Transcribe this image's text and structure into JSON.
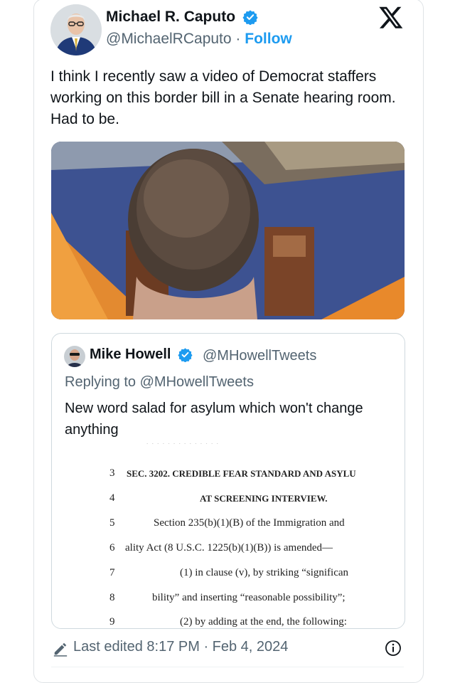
{
  "tweet": {
    "author_name": "Michael R. Caputo",
    "handle": "@MichaelRCaputo",
    "separator": "·",
    "follow_label": "Follow",
    "text": "I think I recently saw a video of Democrat staffers working on this border bill in a Senate hearing room. Had to be.",
    "media_icon": "video-still-image",
    "verified_icon": "verified-badge-icon",
    "platform_icon": "x-logo-icon"
  },
  "quote": {
    "author_name": "Mike Howell",
    "handle": "@MHowellTweets",
    "reply_context": "Replying to @MHowellTweets",
    "text": "New word salad for asylum which won't change anything",
    "document_lines": [
      {
        "num": "3",
        "text": "SEC. 3202. CREDIBLE FEAR STANDARD AND ASYLU"
      },
      {
        "num": "4",
        "text": "AT SCREENING INTERVIEW."
      },
      {
        "num": "5",
        "text": "Section 235(b)(1)(B) of the Immigration and"
      },
      {
        "num": "6",
        "text": "ality Act (8 U.S.C. 1225(b)(1)(B)) is amended—"
      },
      {
        "num": "7",
        "text": "(1) in clause (v), by striking “significan"
      },
      {
        "num": "8",
        "text": "bility” and inserting “reasonable possibility”;"
      },
      {
        "num": "9",
        "text": "(2) by adding at the end, the following:"
      }
    ]
  },
  "footer": {
    "edited_text": "Last edited 8:17 PM · Feb 4, 2024",
    "edit_icon": "pencil-icon",
    "info_icon": "info-icon"
  },
  "colors": {
    "accent": "#1d9bf0",
    "secondary_text": "#536471",
    "primary_text": "#0f1419",
    "border": "#cfd9de"
  }
}
